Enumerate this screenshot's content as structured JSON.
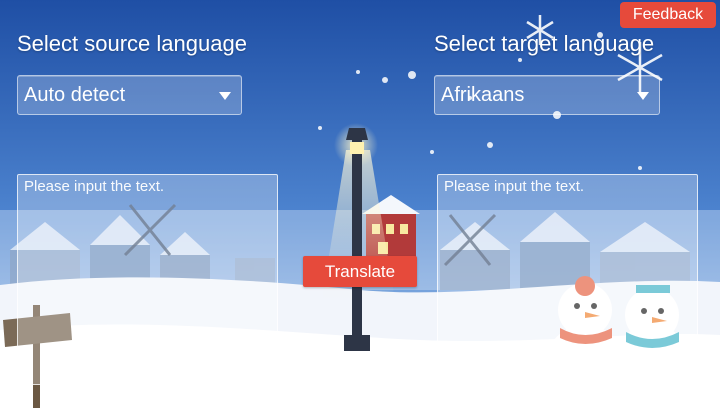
{
  "feedback": {
    "label": "Feedback"
  },
  "source": {
    "label": "Select source language",
    "selected": "Auto detect",
    "placeholder": "Please input the text."
  },
  "target": {
    "label": "Select target language",
    "selected": "Afrikaans",
    "placeholder": "Please input the text."
  },
  "translate": {
    "label": "Translate"
  },
  "icons": {
    "source_dropdown": "chevron-down-icon",
    "target_dropdown": "chevron-down-icon"
  },
  "colors": {
    "accent": "#e64a3b",
    "sky_top": "#1f4fa5",
    "sky_bottom": "#6d9fdc",
    "snow": "#f2f5fb"
  }
}
